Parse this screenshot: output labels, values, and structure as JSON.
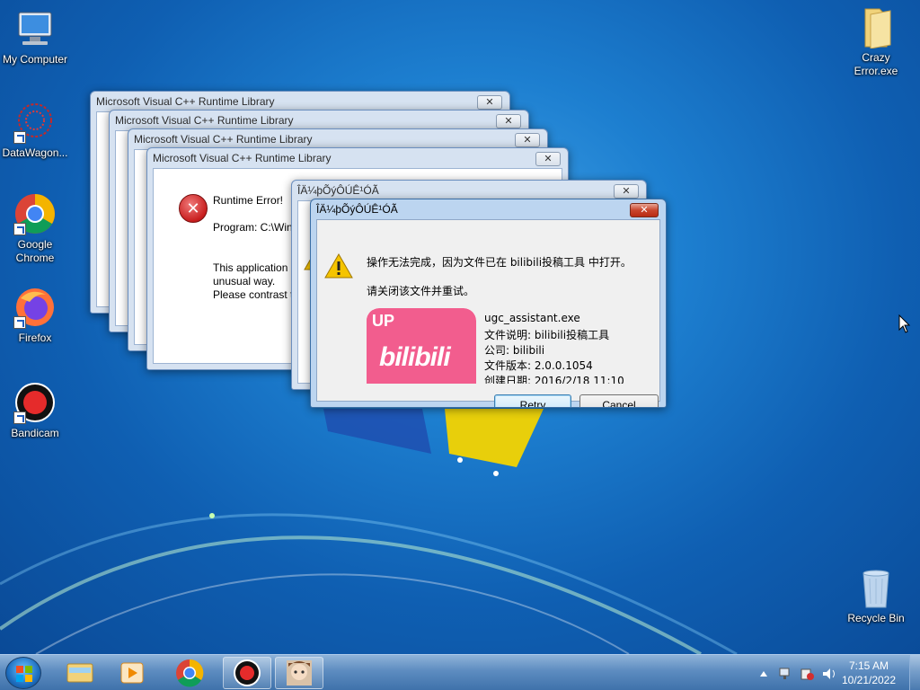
{
  "desktop_icons": [
    {
      "label": "My Computer",
      "icon": "computer-icon"
    },
    {
      "label": "DataWagon...",
      "icon": "datawagon-icon"
    },
    {
      "label": "Google Chrome",
      "icon": "chrome-icon"
    },
    {
      "label": "Firefox",
      "icon": "firefox-icon"
    },
    {
      "label": "Bandicam",
      "icon": "bandicam-icon"
    },
    {
      "label": "Crazy Error.exe",
      "icon": "folder-icon"
    },
    {
      "label": "Recycle Bin",
      "icon": "recycle-bin-icon"
    }
  ],
  "vc_dialogs": {
    "title": "Microsoft Visual C++ Runtime Library",
    "close": "✕",
    "heading": "Runtime Error!",
    "program": "Program: C:\\Wind",
    "line1": "This application h",
    "line2": "unusual way.",
    "line3": "Please contrast th"
  },
  "garbled_dialog_back": {
    "title": "ÎÄ¼þÕýÔÚÊ¹ÓÃ"
  },
  "file_in_use_dialog": {
    "title": "ÎÄ¼þÕýÔÚÊ¹ÓÃ",
    "message": "操作无法完成，因为文件已在 bilibili投稿工具 中打开。",
    "instruction": "请关闭该文件并重试。",
    "logo_badge": "UP",
    "logo_text": "bilibili",
    "file_name": "ugc_assistant.exe",
    "file_description": "文件说明: bilibili投稿工具",
    "company": "公司: bilibili",
    "file_version": "文件版本: 2.0.0.1054",
    "created": "创建日期: 2016/2/18 11:10",
    "retry_label": "Retry",
    "cancel_label": "Cancel"
  },
  "taskbar": {
    "items": [
      {
        "icon": "explorer-icon",
        "running": false
      },
      {
        "icon": "media-player-icon",
        "running": false
      },
      {
        "icon": "chrome-icon",
        "running": false
      },
      {
        "icon": "bandicam-icon",
        "running": true
      },
      {
        "icon": "anime-app-icon",
        "running": true
      }
    ],
    "time": "7:15 AM",
    "date": "10/21/2022"
  },
  "colors": {
    "desktop": "#1d7fd0",
    "error_red": "#c81e1e",
    "warning_yellow": "#f5c400",
    "bilibili_pink": "#f25d8e"
  }
}
